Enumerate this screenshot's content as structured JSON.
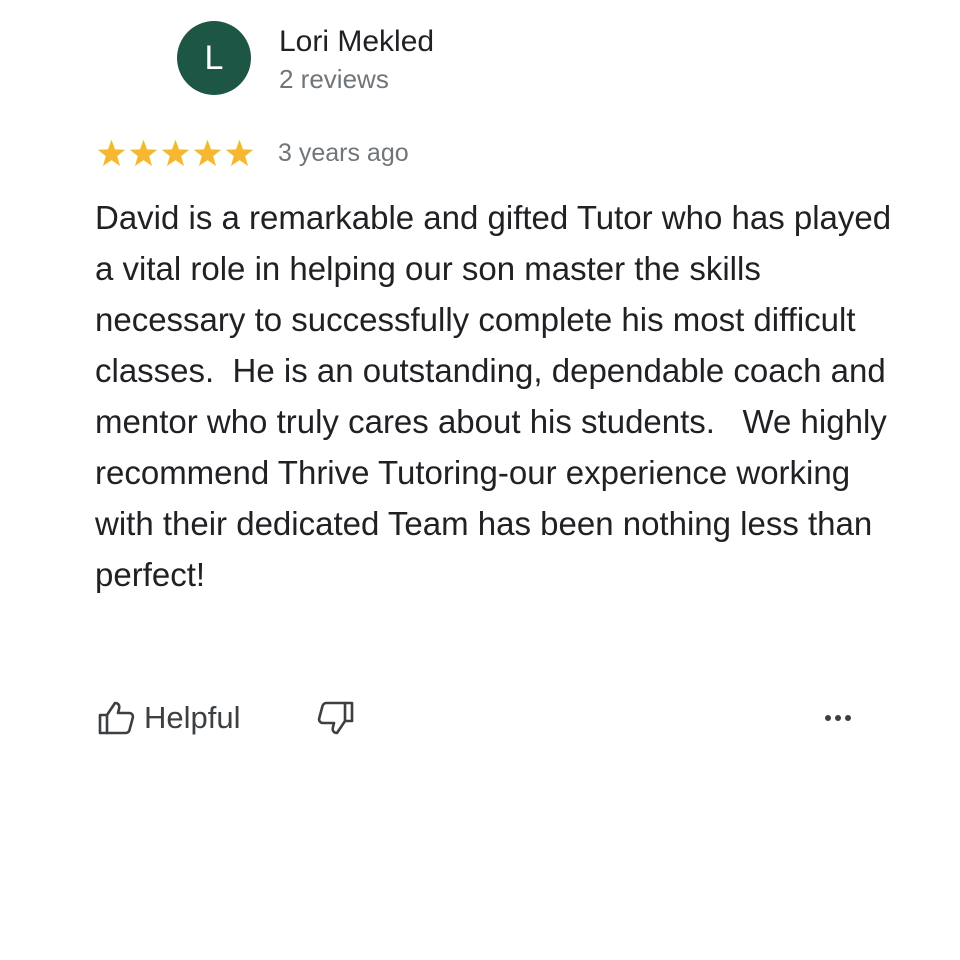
{
  "reviewer": {
    "initial": "L",
    "name": "Lori Mekled",
    "review_count": "2 reviews",
    "avatar_color": "#1e5646"
  },
  "rating": {
    "stars": 5,
    "max_stars": 5,
    "star_color": "#f5b82e",
    "date": "3 years ago"
  },
  "review": {
    "text": "David is a remarkable and gifted Tutor who has played a vital role in helping our son master the skills necessary to successfully complete his most difficult classes.  He is an outstanding, dependable coach and mentor who truly cares about his students.   We highly recommend Thrive Tutoring-our experience working with their dedicated Team has been nothing less than perfect!"
  },
  "actions": {
    "helpful_label": "Helpful",
    "helpful_icon": "thumb-up-icon",
    "not_helpful_icon": "thumb-down-icon",
    "more_icon": "more-options-icon"
  }
}
